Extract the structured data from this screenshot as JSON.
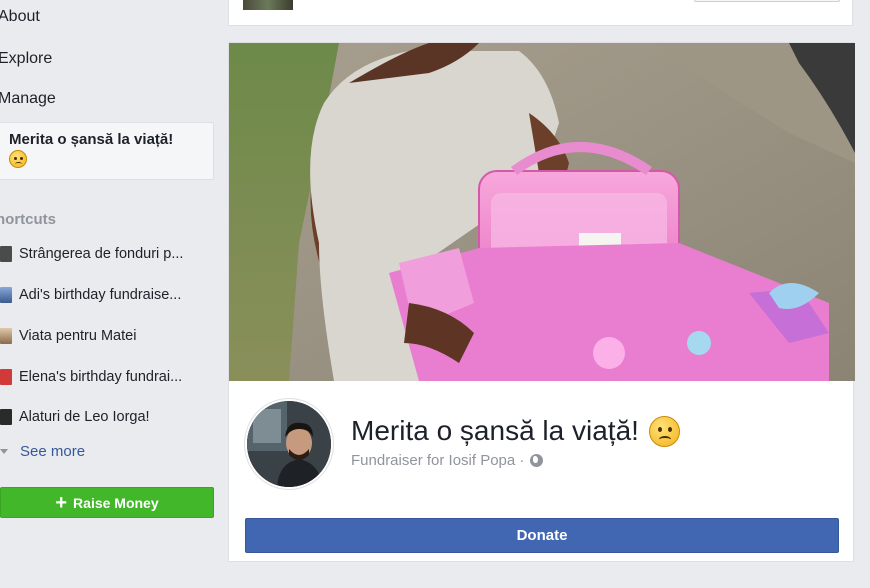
{
  "sidebar": {
    "nav": [
      {
        "label": "About"
      },
      {
        "label": "Explore"
      },
      {
        "label": "Manage"
      }
    ],
    "active_item": {
      "label": "Merita o șansă la viață!",
      "emoji": "worried-face-emoji"
    },
    "shortcuts_label": "hortcuts",
    "shortcuts": [
      {
        "label": "Strângerea de fonduri p...",
        "icon": "fundraiser-thumb-1",
        "color": "#4b4b4b"
      },
      {
        "label": "Adi's birthday fundraise...",
        "icon": "fundraiser-thumb-2",
        "color": "#5b7fb0"
      },
      {
        "label": "Viata pentru Matei",
        "icon": "fundraiser-thumb-3",
        "color": "#b89a7a"
      },
      {
        "label": "Elena's birthday fundrai...",
        "icon": "fundraiser-thumb-4",
        "color": "#d23a3a"
      },
      {
        "label": "Alaturi de Leo Iorga!",
        "icon": "fundraiser-thumb-5",
        "color": "#2a2a2a"
      }
    ],
    "see_more": "See more",
    "raise_money": "Raise Money"
  },
  "fundraiser": {
    "title": "Merita o șansă la viață!",
    "subtitle": "Fundraiser for Iosif Popa ·",
    "donate": "Donate"
  },
  "colors": {
    "primary": "#4267b2",
    "green": "#42b72a",
    "link": "#365899",
    "muted": "#90949c"
  }
}
